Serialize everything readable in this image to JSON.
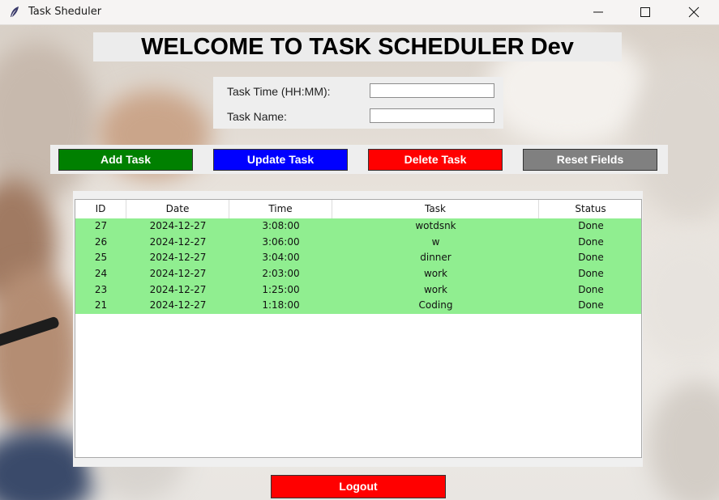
{
  "window": {
    "title": "Task Sheduler",
    "icon": "feather-icon",
    "controls": [
      "minimize-icon",
      "maximize-icon",
      "close-icon"
    ]
  },
  "heading": "WELCOME TO TASK SCHEDULER Dev",
  "form": {
    "time_label": "Task Time (HH:MM):",
    "time_value": "",
    "name_label": "Task Name:",
    "name_value": ""
  },
  "buttons": {
    "add": "Add Task",
    "update": "Update Task",
    "delete": "Delete Task",
    "reset": "Reset Fields",
    "logout": "Logout"
  },
  "colors": {
    "add": "#008000",
    "update": "#0000ff",
    "delete": "#ff0000",
    "reset": "#808080",
    "logout": "#ff0000",
    "row_done": "#90ee90"
  },
  "table": {
    "columns": [
      "ID",
      "Date",
      "Time",
      "Task",
      "Status"
    ],
    "rows": [
      [
        "27",
        "2024-12-27",
        "3:08:00",
        "wotdsnk",
        "Done"
      ],
      [
        "26",
        "2024-12-27",
        "3:06:00",
        "w",
        "Done"
      ],
      [
        "25",
        "2024-12-27",
        "3:04:00",
        "dinner",
        "Done"
      ],
      [
        "24",
        "2024-12-27",
        "2:03:00",
        "work",
        "Done"
      ],
      [
        "23",
        "2024-12-27",
        "1:25:00",
        "work",
        "Done"
      ],
      [
        "21",
        "2024-12-27",
        "1:18:00",
        "Coding",
        "Done"
      ]
    ]
  }
}
